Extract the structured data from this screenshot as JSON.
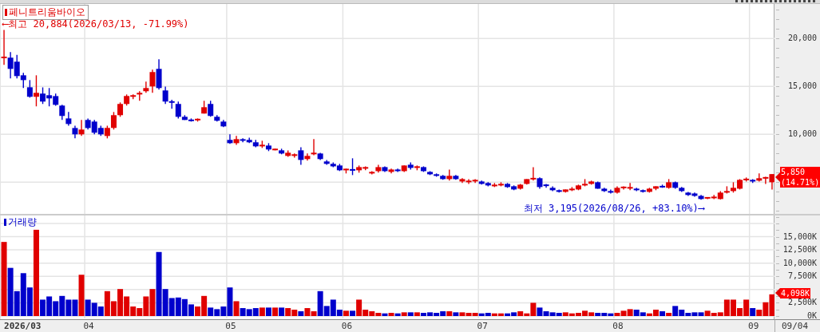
{
  "price_panel": {
    "title": "페니트리움바이오",
    "last_price": "5,850",
    "last_change": "(14.71%)",
    "chart_data": {
      "type": "candlestick",
      "grid": true,
      "ylim": [
        1700,
        23600
      ],
      "yticks": [
        {
          "value": 10000,
          "label": "10,000"
        },
        {
          "value": 15000,
          "label": "15,000"
        },
        {
          "value": 20000,
          "label": "20,000"
        }
      ],
      "categories": [
        null,
        null,
        null,
        null,
        null,
        null,
        null,
        null,
        null,
        null,
        null,
        null,
        null,
        null,
        null,
        null,
        null,
        null,
        null,
        null,
        null,
        null,
        null,
        null,
        null,
        null,
        null,
        null,
        null,
        null,
        null,
        null,
        null,
        null,
        null,
        null,
        null,
        null,
        null,
        null,
        null,
        null,
        null,
        null,
        null,
        null,
        null,
        null,
        null,
        null,
        null,
        null,
        null,
        null,
        null,
        null,
        null,
        null,
        null,
        null,
        null,
        null,
        null,
        null,
        null,
        null,
        null,
        null,
        null,
        null,
        null,
        null,
        null,
        null,
        null,
        null,
        null,
        null,
        null,
        null,
        null,
        null,
        null,
        null,
        null,
        null,
        null,
        null,
        null,
        null,
        null,
        null,
        null,
        null,
        null,
        null,
        null,
        null,
        null,
        null,
        null,
        null,
        null,
        null,
        null,
        null,
        null,
        null,
        null,
        null,
        null,
        null,
        null,
        null,
        null,
        null,
        null,
        null,
        null,
        null
      ],
      "ohlc": [
        [
          18000,
          20884,
          17250,
          18050
        ],
        [
          18000,
          18580,
          15830,
          16830
        ],
        [
          17580,
          18300,
          15830,
          16080
        ],
        [
          16160,
          16410,
          14830,
          15660
        ],
        [
          14910,
          15660,
          13830,
          13920
        ],
        [
          13920,
          16160,
          12920,
          14330
        ],
        [
          14250,
          14900,
          13170,
          13420
        ],
        [
          14080,
          14830,
          12920,
          13750
        ],
        [
          13990,
          14250,
          12990,
          13080
        ],
        [
          13000,
          13080,
          11500,
          11920
        ],
        [
          11660,
          12330,
          10900,
          11080
        ],
        [
          10660,
          10900,
          9580,
          10000
        ],
        [
          10000,
          11500,
          9830,
          10500
        ],
        [
          11500,
          11660,
          10500,
          10660
        ],
        [
          11330,
          11500,
          10000,
          10170
        ],
        [
          10670,
          10900,
          9830,
          10000
        ],
        [
          9830,
          10900,
          9580,
          10670
        ],
        [
          10670,
          12330,
          10500,
          12000
        ],
        [
          12000,
          13330,
          11830,
          13170
        ],
        [
          13170,
          14160,
          13000,
          14000
        ],
        [
          14000,
          14160,
          13670,
          14000
        ],
        [
          14160,
          14500,
          13500,
          14330
        ],
        [
          14500,
          15500,
          14330,
          14830
        ],
        [
          15000,
          16750,
          14330,
          16500
        ],
        [
          16830,
          17830,
          14660,
          14830
        ],
        [
          14580,
          14990,
          13170,
          13420
        ],
        [
          13420,
          13600,
          12670,
          13330
        ],
        [
          13170,
          13420,
          11660,
          11830
        ],
        [
          11830,
          12000,
          11500,
          11500
        ],
        [
          11500,
          11660,
          11330,
          11420
        ],
        [
          11500,
          11660,
          11330,
          11580
        ],
        [
          12170,
          13500,
          12170,
          12830
        ],
        [
          13170,
          13500,
          11830,
          11920
        ],
        [
          11830,
          12000,
          11330,
          11420
        ],
        [
          11330,
          11500,
          10750,
          10830
        ],
        [
          9420,
          10000,
          9000,
          9080
        ],
        [
          9080,
          9830,
          8900,
          9500
        ],
        [
          9420,
          9580,
          9170,
          9400
        ],
        [
          9420,
          9660,
          9080,
          9170
        ],
        [
          9170,
          9420,
          8660,
          8750
        ],
        [
          8830,
          9330,
          8580,
          8830
        ],
        [
          8830,
          9080,
          8250,
          8420
        ],
        [
          8420,
          8500,
          8330,
          8420
        ],
        [
          8330,
          8500,
          7920,
          8000
        ],
        [
          7750,
          8330,
          7660,
          8080
        ],
        [
          7750,
          8000,
          7580,
          7920
        ],
        [
          8330,
          8660,
          6830,
          7330
        ],
        [
          7420,
          8000,
          7250,
          7750
        ],
        [
          8000,
          9500,
          7830,
          8000
        ],
        [
          8000,
          8080,
          7330,
          7420
        ],
        [
          7170,
          7330,
          6830,
          6920
        ],
        [
          6920,
          7080,
          6580,
          6660
        ],
        [
          6750,
          6920,
          6170,
          6250
        ],
        [
          6330,
          6420,
          5920,
          6330
        ],
        [
          6330,
          7500,
          5750,
          6250
        ],
        [
          6250,
          6750,
          6000,
          6580
        ],
        [
          6500,
          6660,
          6250,
          6500
        ],
        [
          5920,
          6160,
          5830,
          6080
        ],
        [
          6160,
          6830,
          6000,
          6580
        ],
        [
          6580,
          6660,
          6080,
          6160
        ],
        [
          6080,
          6420,
          5920,
          6330
        ],
        [
          6330,
          6420,
          6080,
          6160
        ],
        [
          6160,
          6750,
          6080,
          6750
        ],
        [
          6830,
          7080,
          6330,
          6500
        ],
        [
          6580,
          6750,
          6250,
          6580
        ],
        [
          6580,
          6660,
          6080,
          6160
        ],
        [
          6080,
          6160,
          5750,
          5830
        ],
        [
          5830,
          5920,
          5580,
          5670
        ],
        [
          5670,
          5750,
          5250,
          5330
        ],
        [
          5330,
          6330,
          5170,
          5670
        ],
        [
          5670,
          5750,
          5250,
          5330
        ],
        [
          5080,
          5420,
          4920,
          5330
        ],
        [
          5000,
          5330,
          4830,
          5170
        ],
        [
          5170,
          5330,
          4920,
          5170
        ],
        [
          5080,
          5170,
          4750,
          4830
        ],
        [
          4920,
          5000,
          4580,
          4670
        ],
        [
          4580,
          4920,
          4500,
          4750
        ],
        [
          4670,
          5000,
          4580,
          4830
        ],
        [
          4830,
          4920,
          4420,
          4500
        ],
        [
          4580,
          4670,
          4170,
          4250
        ],
        [
          4330,
          4830,
          4250,
          4750
        ],
        [
          4830,
          5330,
          4750,
          5330
        ],
        [
          5330,
          6580,
          5170,
          5420
        ],
        [
          5420,
          5500,
          4330,
          4500
        ],
        [
          4700,
          4830,
          4420,
          4670
        ],
        [
          4420,
          4580,
          4080,
          4170
        ],
        [
          4170,
          4250,
          3920,
          4000
        ],
        [
          4000,
          4250,
          3920,
          4250
        ],
        [
          4250,
          4500,
          4080,
          4250
        ],
        [
          4250,
          4750,
          4170,
          4670
        ],
        [
          4670,
          5330,
          4580,
          4830
        ],
        [
          4830,
          5170,
          4750,
          5080
        ],
        [
          5000,
          5080,
          4330,
          4330
        ],
        [
          4330,
          4420,
          4000,
          4080
        ],
        [
          4080,
          4250,
          3830,
          3920
        ],
        [
          3920,
          4580,
          3830,
          4420
        ],
        [
          4420,
          4580,
          4250,
          4500
        ],
        [
          4420,
          4920,
          4170,
          4420
        ],
        [
          4330,
          4420,
          4080,
          4170
        ],
        [
          4170,
          4250,
          3920,
          4000
        ],
        [
          4000,
          4420,
          3920,
          4330
        ],
        [
          4330,
          4580,
          4170,
          4580
        ],
        [
          4580,
          4750,
          4420,
          4500
        ],
        [
          4420,
          5330,
          4330,
          5000
        ],
        [
          5000,
          5080,
          4330,
          4420
        ],
        [
          4420,
          4500,
          4000,
          4080
        ],
        [
          3920,
          4000,
          3580,
          3670
        ],
        [
          3830,
          3920,
          3500,
          3580
        ],
        [
          3580,
          3670,
          3170,
          3250
        ],
        [
          3330,
          3420,
          3250,
          3420
        ],
        [
          3330,
          3670,
          3250,
          3500
        ],
        [
          3250,
          4080,
          3195,
          3920
        ],
        [
          3920,
          4580,
          3830,
          4080
        ],
        [
          4080,
          5000,
          3920,
          4420
        ],
        [
          4330,
          5330,
          4250,
          5250
        ],
        [
          5250,
          5500,
          5080,
          5330
        ],
        [
          5250,
          5330,
          4920,
          5080
        ],
        [
          5170,
          5920,
          5080,
          5420
        ],
        [
          5420,
          5580,
          4830,
          5500
        ],
        [
          5000,
          5850,
          4250,
          5850
        ]
      ],
      "annotations": [
        "⟵최고 20,884(2026/03/13, -71.99%)",
        "최저 3,195(2026/08/26, +83.10%)⟶"
      ]
    }
  },
  "volume_panel": {
    "label": "거래량",
    "last_volume": "4,098K",
    "chart_data": {
      "type": "bar",
      "grid": true,
      "ylim": [
        0,
        19000
      ],
      "yticks": [
        {
          "value": 0,
          "label": "0K"
        },
        {
          "value": 2500,
          "label": "2,500K"
        },
        {
          "value": 7500,
          "label": "7,500K"
        },
        {
          "value": 10000,
          "label": "10,000K"
        },
        {
          "value": 12500,
          "label": "12,500K"
        },
        {
          "value": 15000,
          "label": "15,000K"
        }
      ],
      "categories": [
        null,
        null,
        null,
        "2026/03",
        null,
        null,
        null,
        null,
        null,
        null,
        null,
        null,
        null,
        "04",
        null,
        null,
        null,
        null,
        null,
        null,
        null,
        null,
        null,
        null,
        null,
        null,
        null,
        null,
        null,
        null,
        null,
        null,
        null,
        null,
        null,
        "05",
        null,
        null,
        null,
        null,
        null,
        null,
        null,
        null,
        null,
        null,
        null,
        null,
        null,
        null,
        null,
        null,
        null,
        "06",
        null,
        null,
        null,
        null,
        null,
        null,
        null,
        null,
        null,
        null,
        null,
        null,
        null,
        null,
        null,
        null,
        null,
        null,
        null,
        null,
        "07",
        null,
        null,
        null,
        null,
        null,
        null,
        null,
        null,
        null,
        null,
        null,
        null,
        null,
        null,
        null,
        null,
        null,
        null,
        null,
        null,
        "08",
        null,
        null,
        null,
        null,
        null,
        null,
        null,
        null,
        null,
        null,
        null,
        null,
        null,
        null,
        null,
        null,
        null,
        null,
        null,
        null,
        "09",
        null,
        null,
        null
      ],
      "values": [
        14000,
        9100,
        4700,
        8100,
        5400,
        16300,
        3100,
        3700,
        2800,
        3800,
        3100,
        3100,
        7800,
        3100,
        2500,
        1800,
        4700,
        2800,
        5100,
        3700,
        1800,
        1500,
        3700,
        5100,
        12100,
        5100,
        3400,
        3500,
        3200,
        2200,
        1800,
        3800,
        1600,
        1300,
        1800,
        5400,
        2800,
        1500,
        1300,
        1500,
        1600,
        1600,
        1600,
        1600,
        1500,
        1200,
        900,
        1500,
        900,
        4700,
        1900,
        3100,
        1200,
        1000,
        1000,
        3100,
        1200,
        900,
        600,
        500,
        600,
        500,
        700,
        700,
        700,
        600,
        700,
        600,
        900,
        900,
        700,
        700,
        600,
        600,
        500,
        600,
        500,
        500,
        500,
        700,
        900,
        500,
        2500,
        1600,
        900,
        700,
        600,
        700,
        500,
        600,
        1000,
        700,
        600,
        600,
        500,
        600,
        1000,
        1300,
        1200,
        700,
        500,
        1200,
        900,
        600,
        1900,
        1200,
        600,
        700,
        700,
        1000,
        600,
        700,
        3100,
        3100,
        1500,
        3100,
        1500,
        1200,
        2600,
        4100
      ]
    }
  },
  "x_axis": {
    "date": "09/04"
  }
}
